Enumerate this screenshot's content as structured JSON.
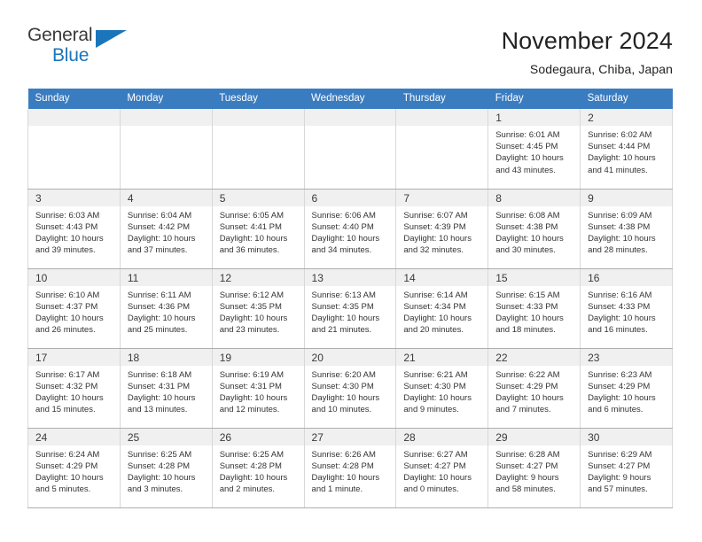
{
  "brand": {
    "name_top": "General",
    "name_bottom": "Blue",
    "triangle_color": "#1b75bb",
    "text_color": "#3b3b3b"
  },
  "header": {
    "title": "November 2024",
    "subtitle": "Sodegaura, Chiba, Japan"
  },
  "calendar": {
    "header_bg": "#3a7cc0",
    "header_text_color": "#ffffff",
    "daynum_band_bg": "#f0f0f0",
    "weekday_headers": [
      "Sunday",
      "Monday",
      "Tuesday",
      "Wednesday",
      "Thursday",
      "Friday",
      "Saturday"
    ],
    "weeks": [
      [
        {
          "day": "",
          "sunrise": "",
          "sunset": "",
          "daylight_1": "",
          "daylight_2": ""
        },
        {
          "day": "",
          "sunrise": "",
          "sunset": "",
          "daylight_1": "",
          "daylight_2": ""
        },
        {
          "day": "",
          "sunrise": "",
          "sunset": "",
          "daylight_1": "",
          "daylight_2": ""
        },
        {
          "day": "",
          "sunrise": "",
          "sunset": "",
          "daylight_1": "",
          "daylight_2": ""
        },
        {
          "day": "",
          "sunrise": "",
          "sunset": "",
          "daylight_1": "",
          "daylight_2": ""
        },
        {
          "day": "1",
          "sunrise": "Sunrise: 6:01 AM",
          "sunset": "Sunset: 4:45 PM",
          "daylight_1": "Daylight: 10 hours",
          "daylight_2": "and 43 minutes."
        },
        {
          "day": "2",
          "sunrise": "Sunrise: 6:02 AM",
          "sunset": "Sunset: 4:44 PM",
          "daylight_1": "Daylight: 10 hours",
          "daylight_2": "and 41 minutes."
        }
      ],
      [
        {
          "day": "3",
          "sunrise": "Sunrise: 6:03 AM",
          "sunset": "Sunset: 4:43 PM",
          "daylight_1": "Daylight: 10 hours",
          "daylight_2": "and 39 minutes."
        },
        {
          "day": "4",
          "sunrise": "Sunrise: 6:04 AM",
          "sunset": "Sunset: 4:42 PM",
          "daylight_1": "Daylight: 10 hours",
          "daylight_2": "and 37 minutes."
        },
        {
          "day": "5",
          "sunrise": "Sunrise: 6:05 AM",
          "sunset": "Sunset: 4:41 PM",
          "daylight_1": "Daylight: 10 hours",
          "daylight_2": "and 36 minutes."
        },
        {
          "day": "6",
          "sunrise": "Sunrise: 6:06 AM",
          "sunset": "Sunset: 4:40 PM",
          "daylight_1": "Daylight: 10 hours",
          "daylight_2": "and 34 minutes."
        },
        {
          "day": "7",
          "sunrise": "Sunrise: 6:07 AM",
          "sunset": "Sunset: 4:39 PM",
          "daylight_1": "Daylight: 10 hours",
          "daylight_2": "and 32 minutes."
        },
        {
          "day": "8",
          "sunrise": "Sunrise: 6:08 AM",
          "sunset": "Sunset: 4:38 PM",
          "daylight_1": "Daylight: 10 hours",
          "daylight_2": "and 30 minutes."
        },
        {
          "day": "9",
          "sunrise": "Sunrise: 6:09 AM",
          "sunset": "Sunset: 4:38 PM",
          "daylight_1": "Daylight: 10 hours",
          "daylight_2": "and 28 minutes."
        }
      ],
      [
        {
          "day": "10",
          "sunrise": "Sunrise: 6:10 AM",
          "sunset": "Sunset: 4:37 PM",
          "daylight_1": "Daylight: 10 hours",
          "daylight_2": "and 26 minutes."
        },
        {
          "day": "11",
          "sunrise": "Sunrise: 6:11 AM",
          "sunset": "Sunset: 4:36 PM",
          "daylight_1": "Daylight: 10 hours",
          "daylight_2": "and 25 minutes."
        },
        {
          "day": "12",
          "sunrise": "Sunrise: 6:12 AM",
          "sunset": "Sunset: 4:35 PM",
          "daylight_1": "Daylight: 10 hours",
          "daylight_2": "and 23 minutes."
        },
        {
          "day": "13",
          "sunrise": "Sunrise: 6:13 AM",
          "sunset": "Sunset: 4:35 PM",
          "daylight_1": "Daylight: 10 hours",
          "daylight_2": "and 21 minutes."
        },
        {
          "day": "14",
          "sunrise": "Sunrise: 6:14 AM",
          "sunset": "Sunset: 4:34 PM",
          "daylight_1": "Daylight: 10 hours",
          "daylight_2": "and 20 minutes."
        },
        {
          "day": "15",
          "sunrise": "Sunrise: 6:15 AM",
          "sunset": "Sunset: 4:33 PM",
          "daylight_1": "Daylight: 10 hours",
          "daylight_2": "and 18 minutes."
        },
        {
          "day": "16",
          "sunrise": "Sunrise: 6:16 AM",
          "sunset": "Sunset: 4:33 PM",
          "daylight_1": "Daylight: 10 hours",
          "daylight_2": "and 16 minutes."
        }
      ],
      [
        {
          "day": "17",
          "sunrise": "Sunrise: 6:17 AM",
          "sunset": "Sunset: 4:32 PM",
          "daylight_1": "Daylight: 10 hours",
          "daylight_2": "and 15 minutes."
        },
        {
          "day": "18",
          "sunrise": "Sunrise: 6:18 AM",
          "sunset": "Sunset: 4:31 PM",
          "daylight_1": "Daylight: 10 hours",
          "daylight_2": "and 13 minutes."
        },
        {
          "day": "19",
          "sunrise": "Sunrise: 6:19 AM",
          "sunset": "Sunset: 4:31 PM",
          "daylight_1": "Daylight: 10 hours",
          "daylight_2": "and 12 minutes."
        },
        {
          "day": "20",
          "sunrise": "Sunrise: 6:20 AM",
          "sunset": "Sunset: 4:30 PM",
          "daylight_1": "Daylight: 10 hours",
          "daylight_2": "and 10 minutes."
        },
        {
          "day": "21",
          "sunrise": "Sunrise: 6:21 AM",
          "sunset": "Sunset: 4:30 PM",
          "daylight_1": "Daylight: 10 hours",
          "daylight_2": "and 9 minutes."
        },
        {
          "day": "22",
          "sunrise": "Sunrise: 6:22 AM",
          "sunset": "Sunset: 4:29 PM",
          "daylight_1": "Daylight: 10 hours",
          "daylight_2": "and 7 minutes."
        },
        {
          "day": "23",
          "sunrise": "Sunrise: 6:23 AM",
          "sunset": "Sunset: 4:29 PM",
          "daylight_1": "Daylight: 10 hours",
          "daylight_2": "and 6 minutes."
        }
      ],
      [
        {
          "day": "24",
          "sunrise": "Sunrise: 6:24 AM",
          "sunset": "Sunset: 4:29 PM",
          "daylight_1": "Daylight: 10 hours",
          "daylight_2": "and 5 minutes."
        },
        {
          "day": "25",
          "sunrise": "Sunrise: 6:25 AM",
          "sunset": "Sunset: 4:28 PM",
          "daylight_1": "Daylight: 10 hours",
          "daylight_2": "and 3 minutes."
        },
        {
          "day": "26",
          "sunrise": "Sunrise: 6:25 AM",
          "sunset": "Sunset: 4:28 PM",
          "daylight_1": "Daylight: 10 hours",
          "daylight_2": "and 2 minutes."
        },
        {
          "day": "27",
          "sunrise": "Sunrise: 6:26 AM",
          "sunset": "Sunset: 4:28 PM",
          "daylight_1": "Daylight: 10 hours",
          "daylight_2": "and 1 minute."
        },
        {
          "day": "28",
          "sunrise": "Sunrise: 6:27 AM",
          "sunset": "Sunset: 4:27 PM",
          "daylight_1": "Daylight: 10 hours",
          "daylight_2": "and 0 minutes."
        },
        {
          "day": "29",
          "sunrise": "Sunrise: 6:28 AM",
          "sunset": "Sunset: 4:27 PM",
          "daylight_1": "Daylight: 9 hours",
          "daylight_2": "and 58 minutes."
        },
        {
          "day": "30",
          "sunrise": "Sunrise: 6:29 AM",
          "sunset": "Sunset: 4:27 PM",
          "daylight_1": "Daylight: 9 hours",
          "daylight_2": "and 57 minutes."
        }
      ]
    ]
  }
}
